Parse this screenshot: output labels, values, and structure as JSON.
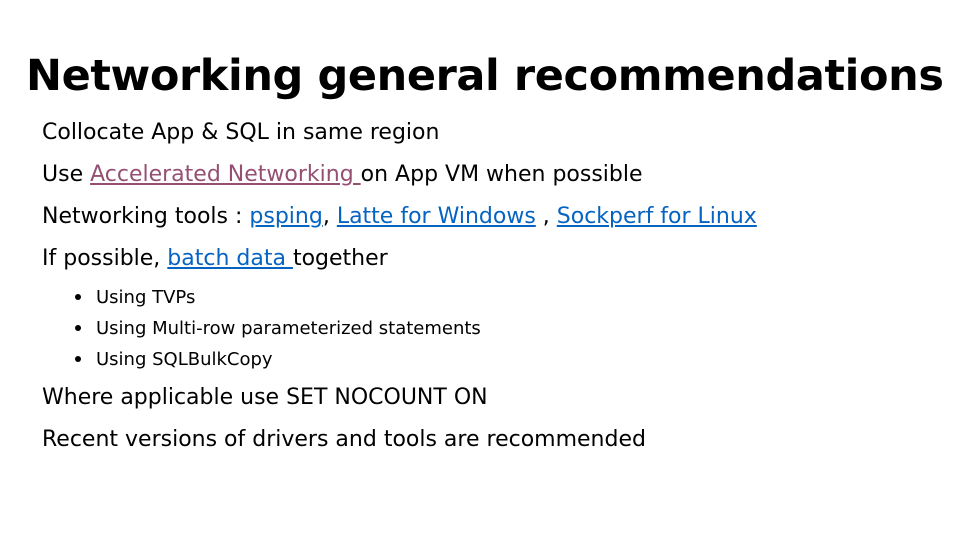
{
  "slide": {
    "title": "Networking general recommendations",
    "bullets": {
      "b1": "Collocate App & SQL in same region",
      "b2": {
        "prefix": "Use ",
        "link": "Accelerated Networking ",
        "suffix": "on App VM when possible"
      },
      "b3": {
        "prefix": "Networking tools : ",
        "link1": "psping",
        "sep1": ", ",
        "link2": "Latte for Windows",
        "sep2": " , ",
        "link3": "Sockperf  for Linux"
      },
      "b4": {
        "prefix": "If possible, ",
        "link": "batch data ",
        "suffix": "together",
        "sub": [
          "Using TVPs",
          "Using Multi-row parameterized statements",
          "Using SQLBulkCopy"
        ]
      },
      "b5": "Where applicable use SET NOCOUNT ON",
      "b6": "Recent versions of drivers and tools are recommended"
    },
    "colors": {
      "visited_link": "#954f72",
      "link": "#0563c1",
      "text": "#000000",
      "background": "#ffffff"
    }
  }
}
